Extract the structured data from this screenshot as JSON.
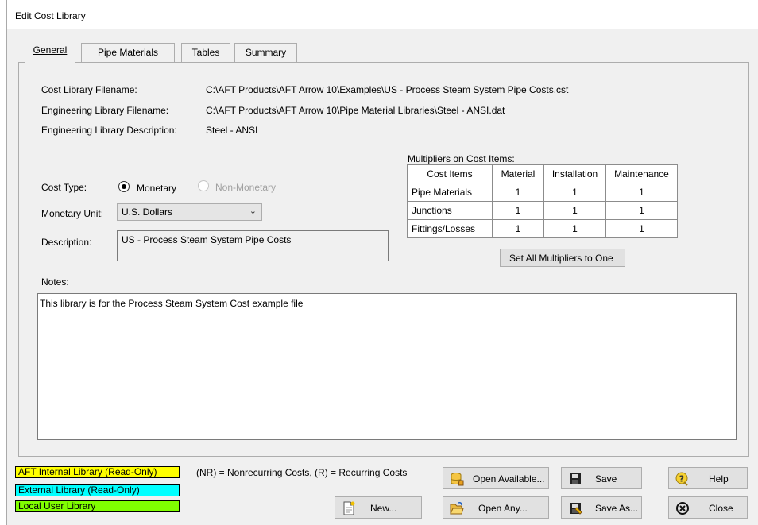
{
  "window": {
    "title": "Edit Cost Library"
  },
  "tabs": [
    {
      "label": "General",
      "active": true
    },
    {
      "label": "Pipe Materials",
      "active": false
    },
    {
      "label": "Tables",
      "active": false
    },
    {
      "label": "Summary",
      "active": false
    }
  ],
  "general": {
    "cost_library_filename_label": "Cost Library Filename:",
    "cost_library_filename": "C:\\AFT Products\\AFT Arrow 10\\Examples\\US - Process Steam System Pipe Costs.cst",
    "eng_library_filename_label": "Engineering Library Filename:",
    "eng_library_filename": "C:\\AFT Products\\AFT Arrow 10\\Pipe Material Libraries\\Steel - ANSI.dat",
    "eng_library_description_label": "Engineering Library Description:",
    "eng_library_description": "Steel - ANSI",
    "cost_type_label": "Cost Type:",
    "cost_type_monetary": "Monetary",
    "cost_type_non_monetary": "Non-Monetary",
    "monetary_unit_label": "Monetary Unit:",
    "monetary_unit_value": "U.S. Dollars",
    "description_label": "Description:",
    "description_value": "US - Process Steam System Pipe Costs",
    "notes_label": "Notes:",
    "notes_value": "This library is for the Process Steam System Cost example file"
  },
  "multipliers": {
    "label": "Multipliers on Cost Items:",
    "headers": [
      "Cost Items",
      "Material",
      "Installation",
      "Maintenance"
    ],
    "rows": [
      {
        "name": "Pipe Materials",
        "material": "1",
        "installation": "1",
        "maintenance": "1"
      },
      {
        "name": "Junctions",
        "material": "1",
        "installation": "1",
        "maintenance": "1"
      },
      {
        "name": "Fittings/Losses",
        "material": "1",
        "installation": "1",
        "maintenance": "1"
      }
    ],
    "set_all_button": "Set All Multipliers to One"
  },
  "legend": {
    "internal": "AFT Internal Library (Read-Only)",
    "external": "External Library (Read-Only)",
    "local": "Local User Library",
    "internal_color": "#ffff00",
    "external_color": "#00ffff",
    "local_color": "#80ff00",
    "note": "(NR) = Nonrecurring Costs, (R) = Recurring Costs"
  },
  "buttons": {
    "new": "New...",
    "open_available": "Open Available...",
    "open_any": "Open Any...",
    "save": "Save",
    "save_as": "Save As...",
    "help": "Help",
    "close": "Close"
  }
}
